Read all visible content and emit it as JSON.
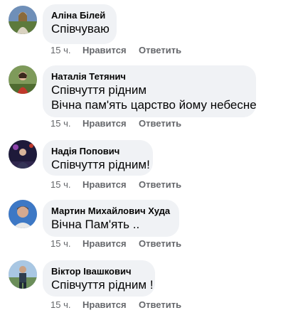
{
  "comments": [
    {
      "author": "Аліна Білей",
      "lines": [
        "Співчуваю"
      ],
      "time": "15 ч.",
      "like": "Нравится",
      "reply": "Ответить",
      "avatar": "avatar-photo"
    },
    {
      "author": "Наталія Тетянич",
      "lines": [
        "Співчуття рідним",
        "Вічна пам'ять царство йому небесне"
      ],
      "time": "15 ч.",
      "like": "Нравится",
      "reply": "Ответить",
      "avatar": "avatar-photo"
    },
    {
      "author": "Надія Попович",
      "lines": [
        "Співчуття рідним!"
      ],
      "time": "15 ч.",
      "like": "Нравится",
      "reply": "Ответить",
      "avatar": "avatar-photo"
    },
    {
      "author": "Мартин Михайлович Худа",
      "lines": [
        "Вічна Пам'ять .."
      ],
      "time": "15 ч.",
      "like": "Нравится",
      "reply": "Ответить",
      "avatar": "avatar-photo"
    },
    {
      "author": "Віктор Івашкович",
      "lines": [
        "Співчуття рідним !"
      ],
      "time": "15 ч.",
      "like": "Нравится",
      "reply": "Ответить",
      "avatar": "avatar-photo"
    }
  ],
  "colors": {
    "bubble": "#f0f2f5",
    "meta": "#65676b",
    "text": "#050505"
  }
}
